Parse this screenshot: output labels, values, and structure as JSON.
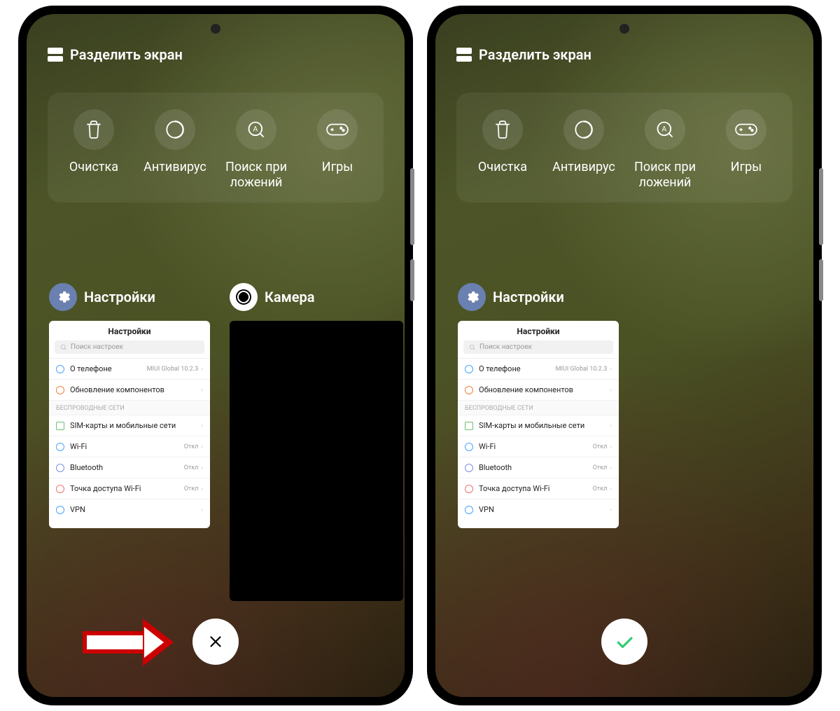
{
  "header": {
    "split_label": "Разделить экран"
  },
  "tools": {
    "clean": "Очистка",
    "antivirus": "Антивирус",
    "search_apps": "Поиск при\nложений",
    "games": "Игры"
  },
  "cards": {
    "settings_title": "Настройки",
    "camera_title": "Камера"
  },
  "settings_preview": {
    "title": "Настройки",
    "search_placeholder": "Поиск настроек",
    "about_phone": "О телефоне",
    "about_phone_value": "MIUI Global 10.2.3",
    "update_components": "Обновление компонентов",
    "wireless_section": "БЕСПРОВОДНЫЕ СЕТИ",
    "sim": "SIM-карты и мобильные сети",
    "wifi": "Wi-Fi",
    "wifi_value": "Откл",
    "bluetooth": "Bluetooth",
    "bluetooth_value": "Откл",
    "hotspot": "Точка доступа Wi-Fi",
    "hotspot_value": "Откл",
    "vpn": "VPN"
  },
  "icons": {
    "trash": "trash",
    "shield": "shield",
    "search": "search",
    "gamepad": "gamepad",
    "gear": "gear"
  }
}
